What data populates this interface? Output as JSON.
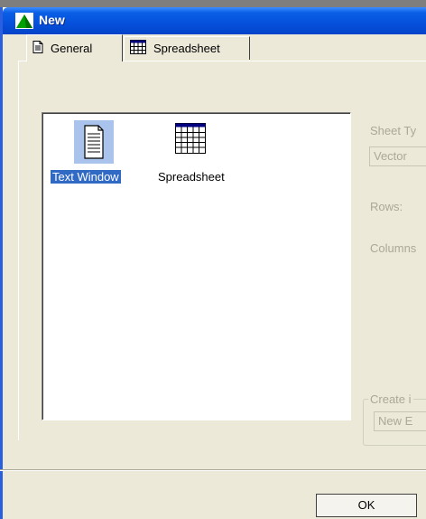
{
  "window": {
    "title": "New"
  },
  "tabs": [
    {
      "label": "General",
      "icon": "document-icon",
      "selected": true
    },
    {
      "label": "Spreadsheet",
      "icon": "grid-icon",
      "selected": false
    }
  ],
  "list_items": [
    {
      "label": "Text Window",
      "icon": "text-document-icon",
      "selected": true
    },
    {
      "label": "Spreadsheet",
      "icon": "spreadsheet-grid-icon",
      "selected": false
    }
  ],
  "options": {
    "sheet_type_label": "Sheet Ty",
    "sheet_type_value": "Vector",
    "rows_label": "Rows:",
    "columns_label": "Columns",
    "create_in_label": "Create i",
    "create_in_value": "New E"
  },
  "buttons": {
    "ok": "OK"
  },
  "colors": {
    "titlebar": "#0550dc",
    "dialog_bg": "#ece9d8",
    "selection": "#316ac5",
    "disabled_text": "#aca899"
  }
}
